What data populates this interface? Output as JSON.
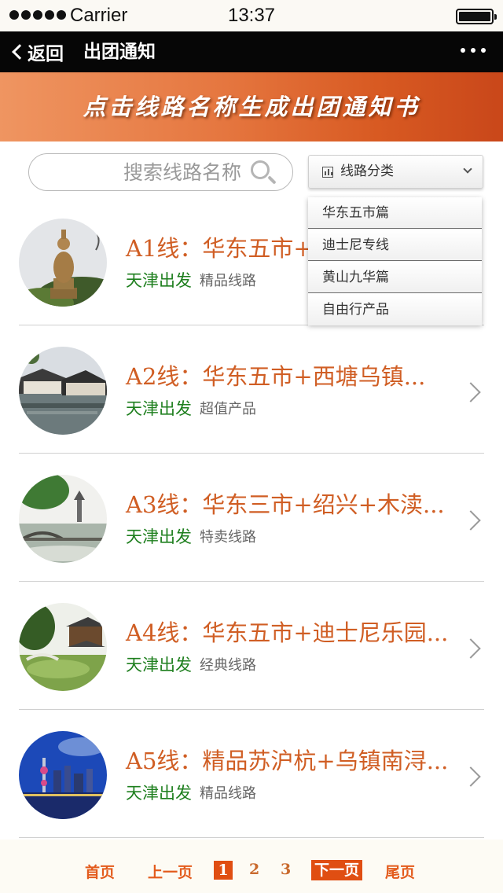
{
  "status_bar": {
    "carrier": "Carrier",
    "time": "13:37"
  },
  "nav": {
    "back_label": "返回",
    "title": "出团通知"
  },
  "banner": {
    "text": "点击线路名称生成出团通知书"
  },
  "search": {
    "placeholder": "搜索线路名称"
  },
  "category": {
    "selected_label": "线路分类",
    "options": [
      "华东五市篇",
      "迪士尼专线",
      "黄山九华篇",
      "自由行产品"
    ]
  },
  "routes": [
    {
      "title": "A1线：华东五市+灵山大佛...",
      "origin": "天津出发",
      "tag": "精品线路",
      "image": "buddha-statue"
    },
    {
      "title": "A2线：华东五市+西塘乌镇...",
      "origin": "天津出发",
      "tag": "超值产品",
      "image": "water-town"
    },
    {
      "title": "A3线：华东三市+绍兴+木渎...",
      "origin": "天津出发",
      "tag": "特卖线路",
      "image": "west-lake-bridge"
    },
    {
      "title": "A4线：华东五市+迪士尼乐园...",
      "origin": "天津出发",
      "tag": "经典线路",
      "image": "classical-garden"
    },
    {
      "title": "A5线：精品苏沪杭+乌镇南浔...",
      "origin": "天津出发",
      "tag": "精品线路",
      "image": "shanghai-skyline"
    }
  ],
  "pagination": {
    "first": "首页",
    "prev": "上一页",
    "pages": [
      "1",
      "2",
      "3"
    ],
    "current_page": "1",
    "next": "下一页",
    "last": "尾页"
  },
  "colors": {
    "nav_background": "#060606",
    "banner_gradient_start": "#ef9561",
    "banner_gradient_end": "#c9471a",
    "route_title": "#d05e24",
    "origin_green": "#1e7f1e",
    "pagination_accent": "#e04e12"
  }
}
